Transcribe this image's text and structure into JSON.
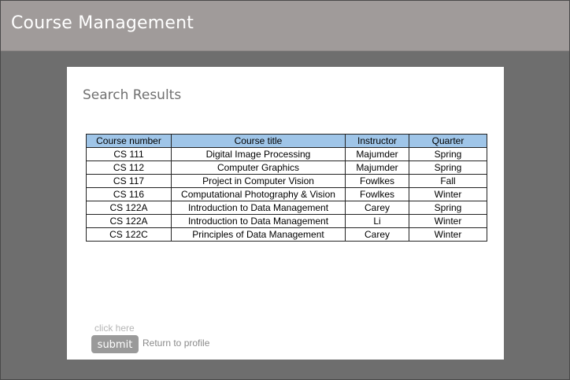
{
  "header": {
    "title": "Course Management"
  },
  "results": {
    "title": "Search Results",
    "columns": [
      "Course number",
      "Course title",
      "Instructor",
      "Quarter"
    ],
    "rows": [
      [
        "CS 111",
        "Digital Image Processing",
        "Majumder",
        "Spring"
      ],
      [
        "CS 112",
        "Computer Graphics",
        "Majumder",
        "Spring"
      ],
      [
        "CS 117",
        "Project in Computer Vision",
        "Fowlkes",
        "Fall"
      ],
      [
        "CS 116",
        "Computational Photography & Vision",
        "Fowlkes",
        "Winter"
      ],
      [
        "CS 122A",
        "Introduction to Data Management",
        "Carey",
        "Spring"
      ],
      [
        "CS 122A",
        "Introduction to Data Management",
        "Li",
        "Winter"
      ],
      [
        "CS 122C",
        "Principles of Data Management",
        "Carey",
        "Winter"
      ]
    ],
    "header_color": "#9fc5e8"
  },
  "actions": {
    "hint": "click here",
    "submit_label": "submit",
    "profile_link": "Return to profile"
  }
}
